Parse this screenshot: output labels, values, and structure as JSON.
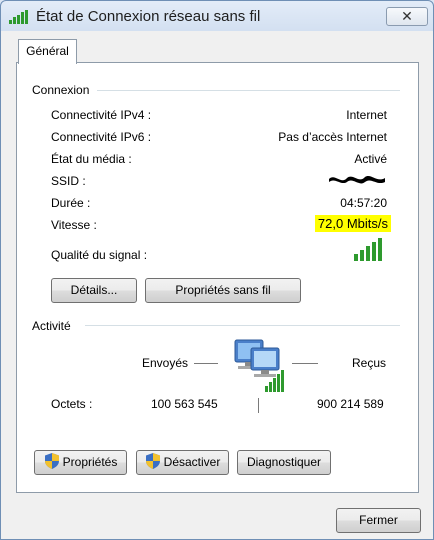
{
  "window": {
    "title": "État de Connexion réseau sans fil",
    "close_glyph": "✕"
  },
  "tabs": [
    {
      "label": "Général",
      "selected": true
    }
  ],
  "connexion": {
    "heading": "Connexion",
    "rows": [
      {
        "label": "Connectivité IPv4 :",
        "value": "Internet"
      },
      {
        "label": "Connectivité IPv6 :",
        "value": "Pas d’accès Internet"
      },
      {
        "label": "État du média :",
        "value": "Activé"
      },
      {
        "label": "SSID :",
        "value": ""
      },
      {
        "label": "Durée :",
        "value": "04:57:20"
      },
      {
        "label": "Vitesse :",
        "value": "72,0 Mbits/s"
      }
    ],
    "signal_label": "Qualité du signal :",
    "signal_bars_lit": 5,
    "signal_bars_total": 5,
    "details_button": "Détails...",
    "wireless_props_button": "Propriétés sans fil"
  },
  "activity": {
    "heading": "Activité",
    "sent_label": "Envoyés",
    "received_label": "Reçus",
    "bytes_label": "Octets :",
    "bytes_sent": "100 563 545",
    "bytes_received": "900 214 589"
  },
  "actions": {
    "properties": "Propriétés",
    "disable": "Désactiver",
    "diagnose": "Diagnostiquer"
  },
  "footer": {
    "close_button": "Fermer"
  },
  "icons": {
    "title": "wifi-signal-icon",
    "shield": "uac-shield-icon",
    "network": "network-computers-icon"
  },
  "colors": {
    "signal_green": "#2e9a2e",
    "highlight": "#ffff00",
    "shield_blue": "#3a6fc4",
    "shield_gold": "#f2c12e"
  }
}
